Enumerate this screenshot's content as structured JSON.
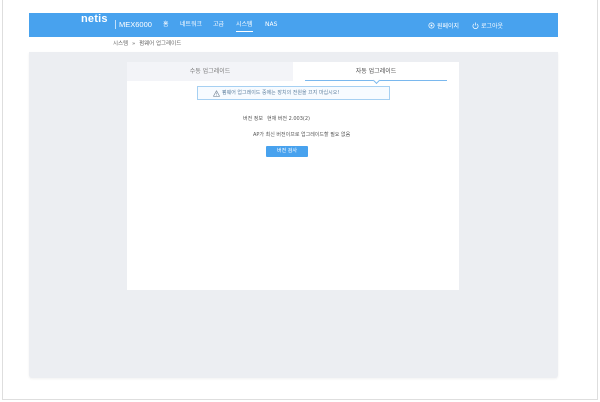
{
  "header": {
    "logo": "netis",
    "separator": "|",
    "model": "MEX6000",
    "nav": [
      {
        "label": "홈",
        "active": false
      },
      {
        "label": "네트워크",
        "active": false
      },
      {
        "label": "고급",
        "active": false
      },
      {
        "label": "시스템",
        "active": true
      },
      {
        "label": "NAS",
        "active": false
      }
    ],
    "actions": [
      {
        "icon": "gear-icon",
        "label": "원페이지"
      },
      {
        "icon": "power-icon",
        "label": "로그아웃"
      }
    ]
  },
  "breadcrumb": {
    "parent": "시스템",
    "separator": "»",
    "current": "펌웨어 업그레이드"
  },
  "upgrade_panel": {
    "tabs": [
      {
        "label": "수동 업그레이드",
        "active": false
      },
      {
        "label": "자동 업그레이드",
        "active": true
      }
    ],
    "notice": {
      "icon": "warning-icon",
      "text": "펌웨어 업그레이드 중에는 장치의 전원을 끄지 마십시오!"
    },
    "version": {
      "label": "버전 정보",
      "value": "현재 버전 2.003(2)"
    },
    "status_message": "AP가 최신 버전이므로 업그레이드할 필요 없음",
    "check_button": {
      "label": "버전 검사"
    }
  },
  "colors": {
    "brand": "#48a2ee",
    "background": "#eceef2",
    "notice_border": "#a6d0f2"
  }
}
